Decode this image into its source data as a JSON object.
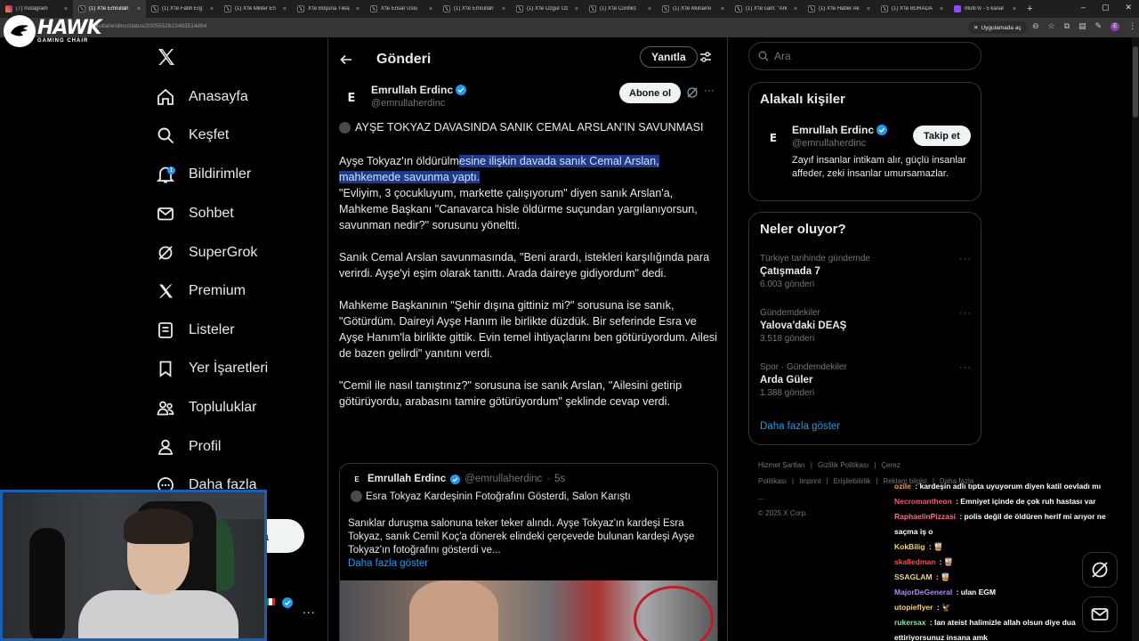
{
  "browser": {
    "tabs": [
      {
        "label": "(7) Instagram",
        "icon": "instagram-icon",
        "active": false
      },
      {
        "label": "(1) X'te Emrullah",
        "icon": "x-icon",
        "active": true
      },
      {
        "label": "(1) X'te Fatih Erg",
        "icon": "x-icon",
        "active": false
      },
      {
        "label": "(1) X'te Militer En",
        "icon": "x-icon",
        "active": false
      },
      {
        "label": "X'te Boşuna Tıkla",
        "icon": "x-icon",
        "active": false
      },
      {
        "label": "X'te Ensar Uslu",
        "icon": "x-icon",
        "active": false
      },
      {
        "label": "(1) X'te Emrullah",
        "icon": "x-icon",
        "active": false
      },
      {
        "label": "(1) X'te Özgür Öz",
        "icon": "x-icon",
        "active": false
      },
      {
        "label": "(1) X'te Conflict",
        "icon": "x-icon",
        "active": false
      },
      {
        "label": "(1) X'te Muharre",
        "icon": "x-icon",
        "active": false
      },
      {
        "label": "(1) X'te cam: \"Ark",
        "icon": "x-icon",
        "active": false
      },
      {
        "label": "(1) X'te Haber Ak",
        "icon": "x-icon",
        "active": false
      },
      {
        "label": "(1) X'te BURADA",
        "icon": "x-icon",
        "active": false
      },
      {
        "label": "Multi tv - 5 kanal",
        "icon": "twitch-icon",
        "active": false
      }
    ],
    "url": "emrullaherdinc/status/2005552623483514894",
    "install_chip": "Uygulamada aç",
    "profile_initial": "E"
  },
  "overlay": {
    "brand_name": "HAWK",
    "brand_sub": "GAMING CHAIR"
  },
  "nav": {
    "items": [
      {
        "label": "Anasayfa",
        "icon": "home-icon"
      },
      {
        "label": "Keşfet",
        "icon": "search-icon"
      },
      {
        "label": "Bildirimler",
        "icon": "bell-icon",
        "badge": "1"
      },
      {
        "label": "Sohbet",
        "icon": "mail-icon"
      },
      {
        "label": "SuperGrok",
        "icon": "grok-icon"
      },
      {
        "label": "Premium",
        "icon": "x-premium-icon"
      },
      {
        "label": "Listeler",
        "icon": "list-icon"
      },
      {
        "label": "Yer İşaretleri",
        "icon": "bookmark-icon"
      },
      {
        "label": "Topluluklar",
        "icon": "communities-icon"
      },
      {
        "label": "Profil",
        "icon": "profile-icon"
      },
      {
        "label": "Daha fazla",
        "icon": "more-circle-icon"
      }
    ],
    "post_button_partial": "a",
    "profile_more": "..."
  },
  "post_page": {
    "title": "Gönderi",
    "reply_sort": "Yanıtla",
    "author": {
      "name": "Emrullah Erdinc",
      "handle": "@emrullaherdinc",
      "avatar_text": "E",
      "subscribe_label": "Abone ol"
    },
    "headline": "AYŞE TOKYAZ DAVASINDA SANIK CEMAL ARSLAN'IN SAVUNMASI",
    "body": {
      "p1_plain": "Ayşe Tokyaz'ın öldürülm",
      "p1_selected_1": "esine ilişkin davada sanık Cemal Arslan,",
      "p1_selected_2": "mahkemede savunma yaptı.",
      "p1_rest": "\"Evliyim, 3 çocukluyum, markette çalışıyorum\" diyen sanık Arslan'a, Mahkeme Başkanı \"Canavarca hisle öldürme suçundan yargılanıyorsun, savunman nedir?\" sorusunu yöneltti.",
      "p2": "Sanık Cemal Arslan savunmasında, \"Beni arardı, istekleri karşılığında para verirdi. Ayşe'yi eşim olarak tanıttı. Arada daireye gidiyordum\" dedi.",
      "p3": "Mahkeme Başkanının \"Şehir dışına gittiniz mi?\" sorusuna ise sanık, \"Götürdüm. Daireyi Ayşe Hanım ile birlikte düzdük. Bir seferinde Esra ve Ayşe Hanım'la birlikte gittik. Evin temel ihtiyaçlarını ben götürüyordum. Ailesi de bazen gelirdi\" yanıtını verdi.",
      "p4": "\"Cemil ile nasıl tanıştınız?\" sorusuna ise sanık Arslan, \"Ailesini getirip götürüyordu, arabasını tamire götürüyordum\" şeklinde cevap verdi."
    },
    "quote": {
      "name": "Emrullah Erdinc",
      "handle": "@emrullaherdinc",
      "separator": "·",
      "time": "5s",
      "title": "Esra Tokyaz Kardeşinin Fotoğrafını Gösterdi, Salon Karıştı",
      "text": "Sanıklar duruşma salonuna teker teker alındı. Ayşe Tokyaz'ın kardeşi Esra Tokyaz, sanık Cemil Koç'a dönerek elindeki çerçevede bulunan kardeşi Ayşe Tokyaz'ın fotoğrafını gösterdi ve...",
      "more": "Daha fazla göster"
    }
  },
  "right": {
    "search_placeholder": "Ara",
    "relevant": {
      "title": "Alakalı kişiler",
      "name": "Emrullah Erdinc",
      "handle": "@emrullaherdinc",
      "follow_label": "Takip et",
      "bio": "Zayıf insanlar intikam alır, güçlü insanlar affeder, zeki insanlar umursamazlar."
    },
    "trends": {
      "title": "Neler oluyor?",
      "items": [
        {
          "context": "Türkiye tarihinde gündemde",
          "name": "Çatışmada 7",
          "count": "6.003 gönderi"
        },
        {
          "context": "Gündemdekiler",
          "name": "Yalova'daki DEAŞ",
          "count": "3.518 gönderi"
        },
        {
          "context": "Spor · Gündemdekiler",
          "name": "Arda Güler",
          "count": "1.388 gönderi"
        }
      ],
      "show_more": "Daha fazla göster"
    },
    "footer": {
      "links": [
        "Hizmet Şartları",
        "|",
        "Gizlilik Politikası",
        "|",
        "Çerez Politikası",
        "|",
        "Imprint",
        "|",
        "Erişilebilirlik",
        "|",
        "Reklam bilgisi",
        "|",
        "Daha fazla ..."
      ],
      "copyright": "© 2025 X Corp."
    }
  },
  "chat": {
    "messages": [
      {
        "user": "ozile",
        "color": "#ff9f43",
        "text": "kardeşin adlı tıpta uyuyorum diyen katil oevladı mı"
      },
      {
        "user": "Necromantheon",
        "color": "#ff4d6d",
        "text": "Emniyet içinde de çok ruh hastası var"
      },
      {
        "user": "RaphaelinPizzasi",
        "color": "#ff6b81",
        "text": "polis değil de öldüren herif mi arıyor ne"
      },
      {
        "user": "",
        "color": "#ffffff",
        "text": "saçma iş o"
      },
      {
        "user": "KokBilig",
        "color": "#f5d76e",
        "text": "🥃"
      },
      {
        "user": "skalledman",
        "color": "#ff4d4d",
        "text": "🥃"
      },
      {
        "user": "SSAGLAM",
        "color": "#f5d76e",
        "text": "🥃"
      },
      {
        "user": "MajorDeGeneral",
        "color": "#b388ff",
        "text": "ulan EGM"
      },
      {
        "user": "utopieflyer",
        "color": "#ffd166",
        "text": "🦅"
      },
      {
        "user": "rukersax",
        "color": "#7bed9f",
        "text": "lan ateist halimizle allah olsun diye dua"
      },
      {
        "user": "",
        "color": "#ffffff",
        "text": "ettiriyorsunuz insana amk"
      }
    ]
  },
  "colors": {
    "accent": "#1d9bf0",
    "background": "#000000",
    "border": "#2f3336",
    "muted": "#71767b",
    "selection": "#1e3a8a"
  }
}
